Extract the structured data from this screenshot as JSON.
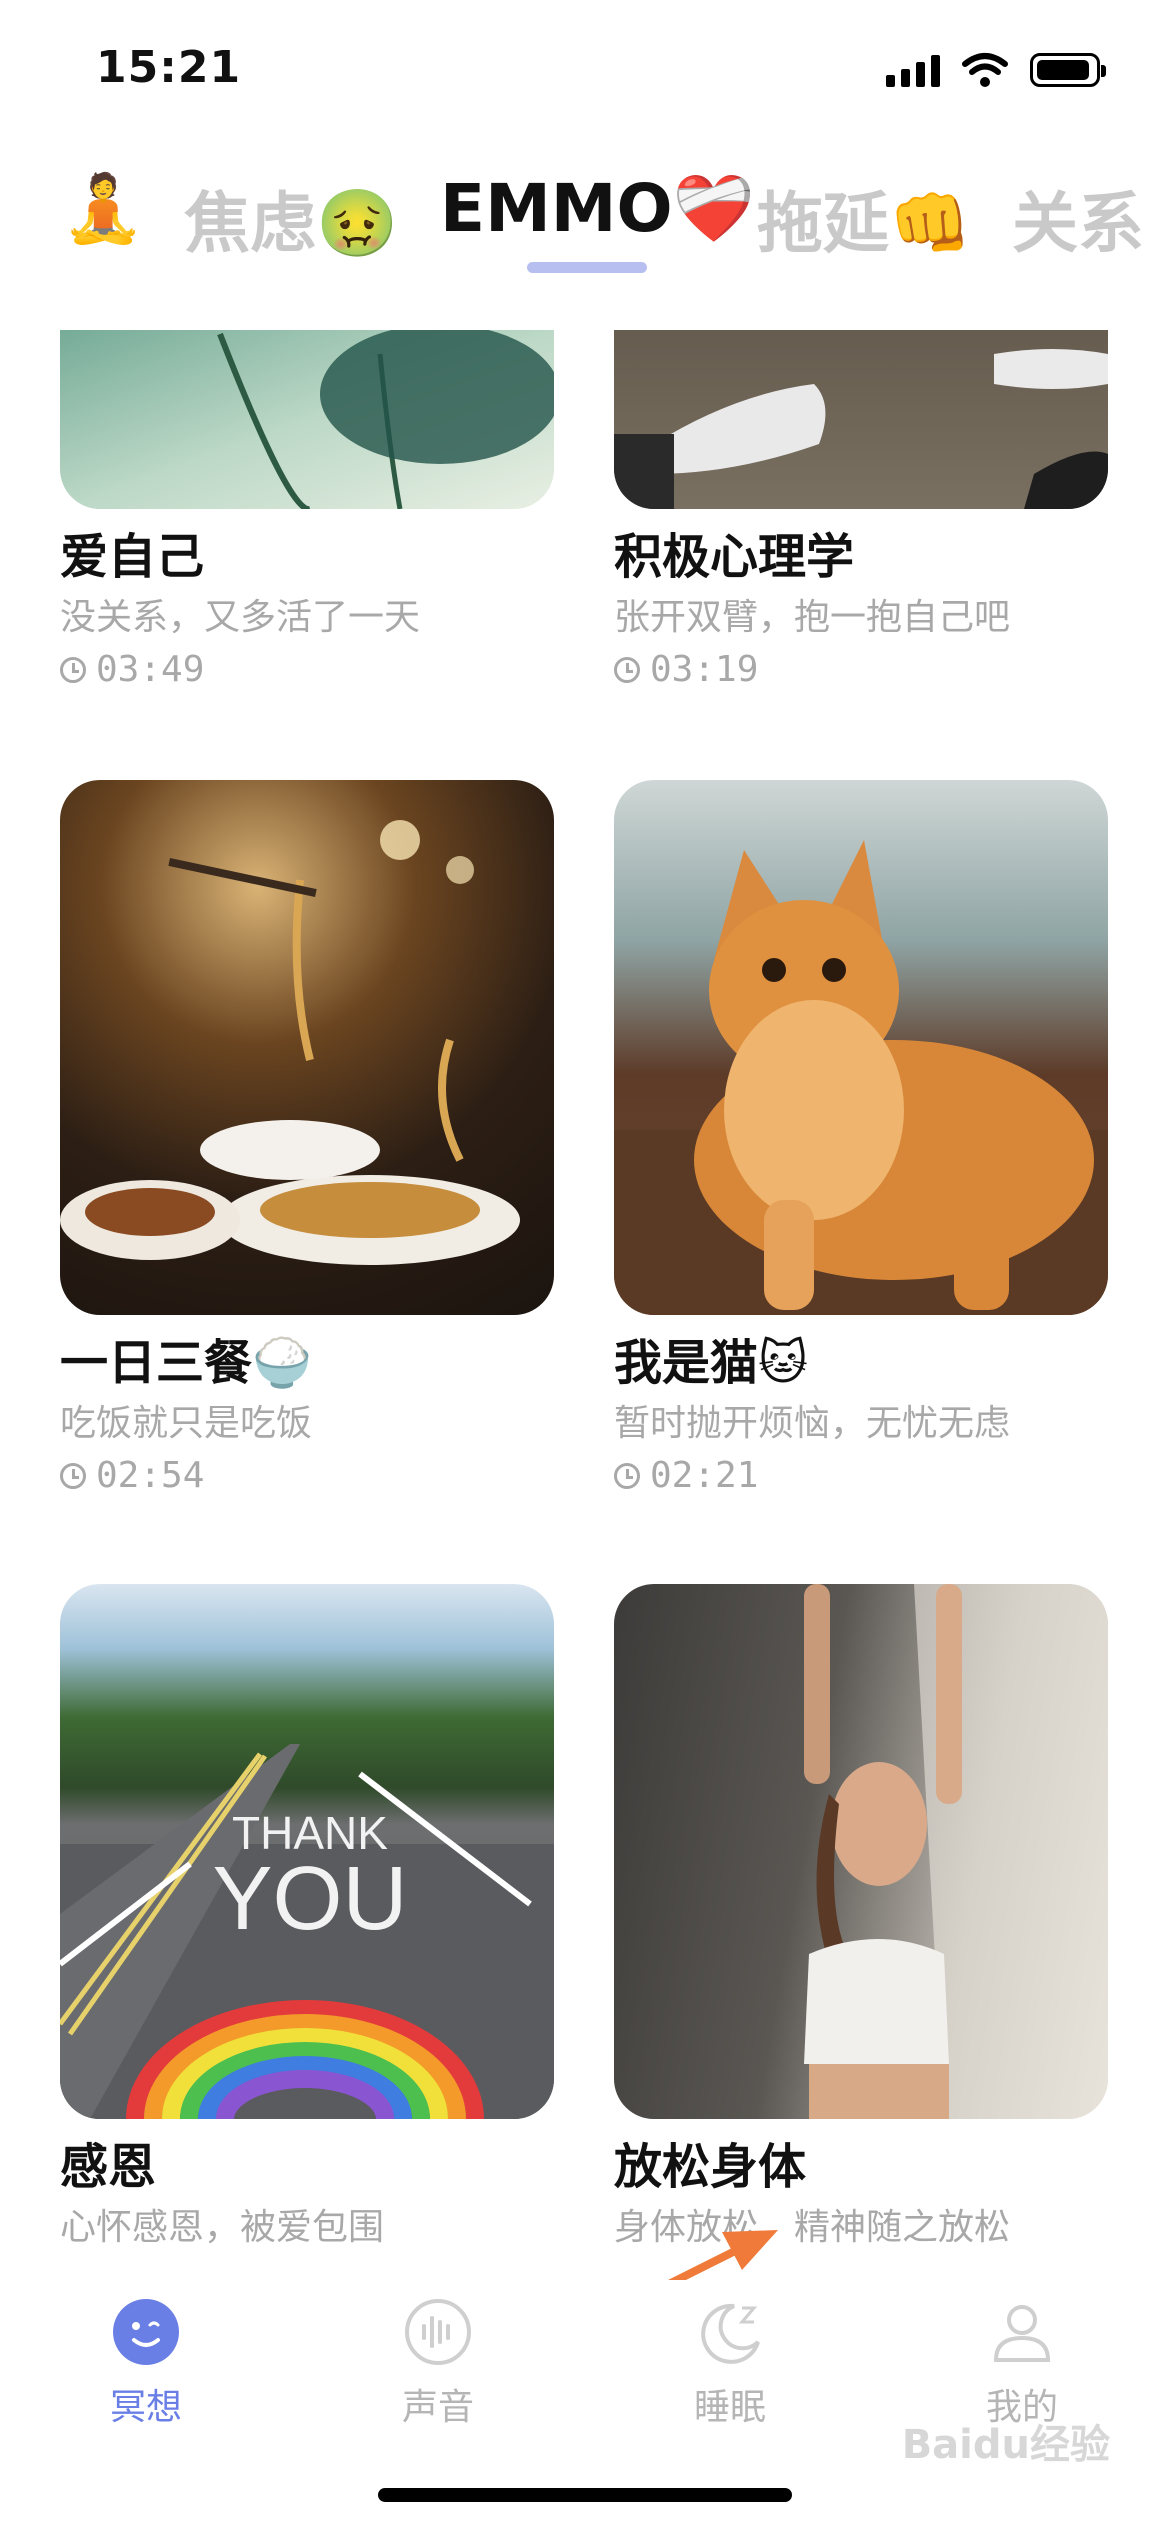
{
  "status_bar": {
    "time": "15:21"
  },
  "tabs": [
    {
      "label": "🧘",
      "active": false
    },
    {
      "label": "焦虑🤢",
      "active": false
    },
    {
      "label": "EMMO❤️‍🩹",
      "active": true
    },
    {
      "label": "拖延👊",
      "active": false
    },
    {
      "label": "关系",
      "active": false
    }
  ],
  "cards": [
    {
      "title": "爱自己",
      "subtitle": "没关系，又多活了一天",
      "duration": "03:49",
      "image": "leaf-photo"
    },
    {
      "title": "积极心理学",
      "subtitle": "张开双臂，抱一抱自己吧",
      "duration": "03:19",
      "image": "sneakers-photo"
    },
    {
      "title": "一日三餐🍚",
      "subtitle": "吃饭就只是吃饭",
      "duration": "02:54",
      "image": "noodles-photo"
    },
    {
      "title": "我是猫🐱",
      "subtitle": "暂时抛开烦恼，无忧无虑",
      "duration": "02:21",
      "image": "cat-photo"
    },
    {
      "title": "感恩",
      "subtitle": "心怀感恩，被爱包围",
      "duration": "",
      "image": "road-thank-you-photo"
    },
    {
      "title": "放松身体",
      "subtitle": "身体放松，精神随之放松",
      "duration": "",
      "image": "woman-stretching-photo"
    }
  ],
  "road_text": {
    "line1": "THANK",
    "line2": "YOU"
  },
  "bottom_nav": [
    {
      "label": "冥想",
      "icon": "smile-face-icon",
      "active": true
    },
    {
      "label": "声音",
      "icon": "sound-wave-icon",
      "active": false
    },
    {
      "label": "睡眠",
      "icon": "moon-sleep-icon",
      "active": false
    },
    {
      "label": "我的",
      "icon": "person-icon",
      "active": false
    }
  ],
  "watermark": "Baidu经验",
  "colors": {
    "accent": "#6a7fe6",
    "tab_indicator": "#b7bff0",
    "muted_text": "#a8a8a8",
    "arrow": "#f07a3a"
  }
}
